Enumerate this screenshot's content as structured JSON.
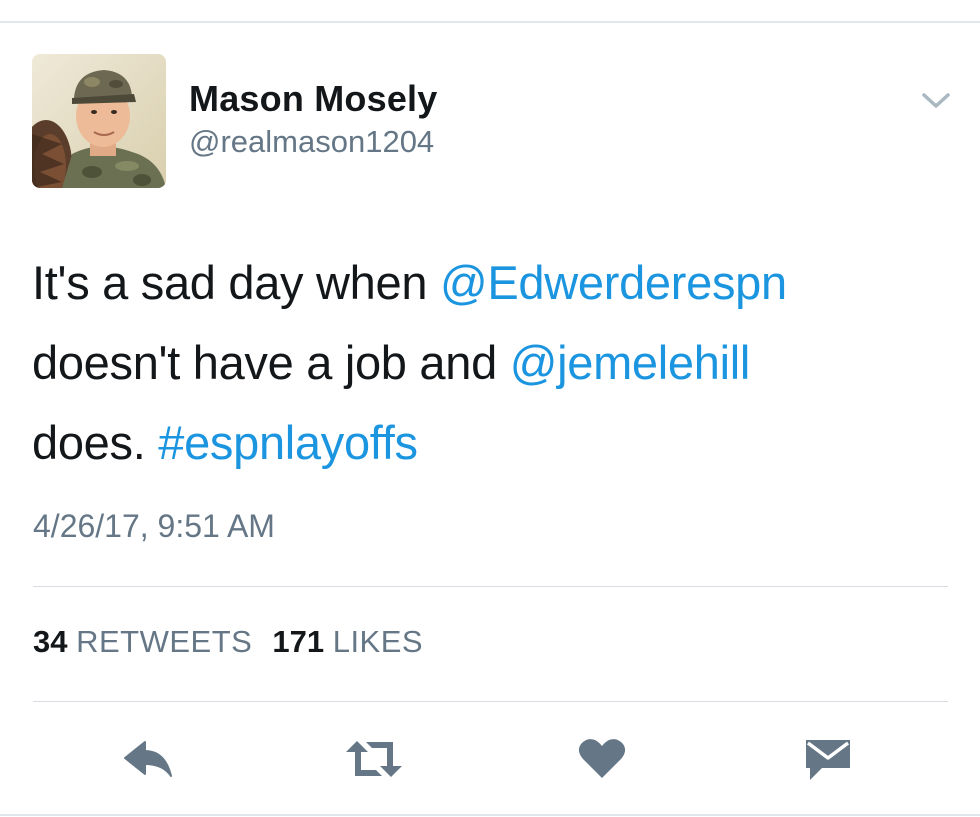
{
  "tweet": {
    "author": {
      "display_name": "Mason Mosely",
      "handle": "@realmason1204"
    },
    "text": {
      "line1": {
        "before": "It's a sad day when ",
        "mention": "@Edwerderespn"
      },
      "line2": {
        "before": "doesn't have a job and ",
        "mention": "@jemelehill"
      },
      "line3": {
        "before": "does. ",
        "hashtag": "#espnlayoffs"
      }
    },
    "timestamp": "4/26/17, 9:51 AM",
    "stats": {
      "retweets_count": "34",
      "retweets_label": "RETWEETS",
      "likes_count": "171",
      "likes_label": "LIKES"
    },
    "actions": {
      "reply_icon": "reply-icon",
      "retweet_icon": "retweet-icon",
      "like_icon": "heart-icon",
      "dm_icon": "envelope-icon"
    }
  },
  "colors": {
    "link": "#1b95e0",
    "secondary_text": "#657786",
    "primary_text": "#14171a",
    "icon": "#657786",
    "divider": "#e1e8ed"
  }
}
